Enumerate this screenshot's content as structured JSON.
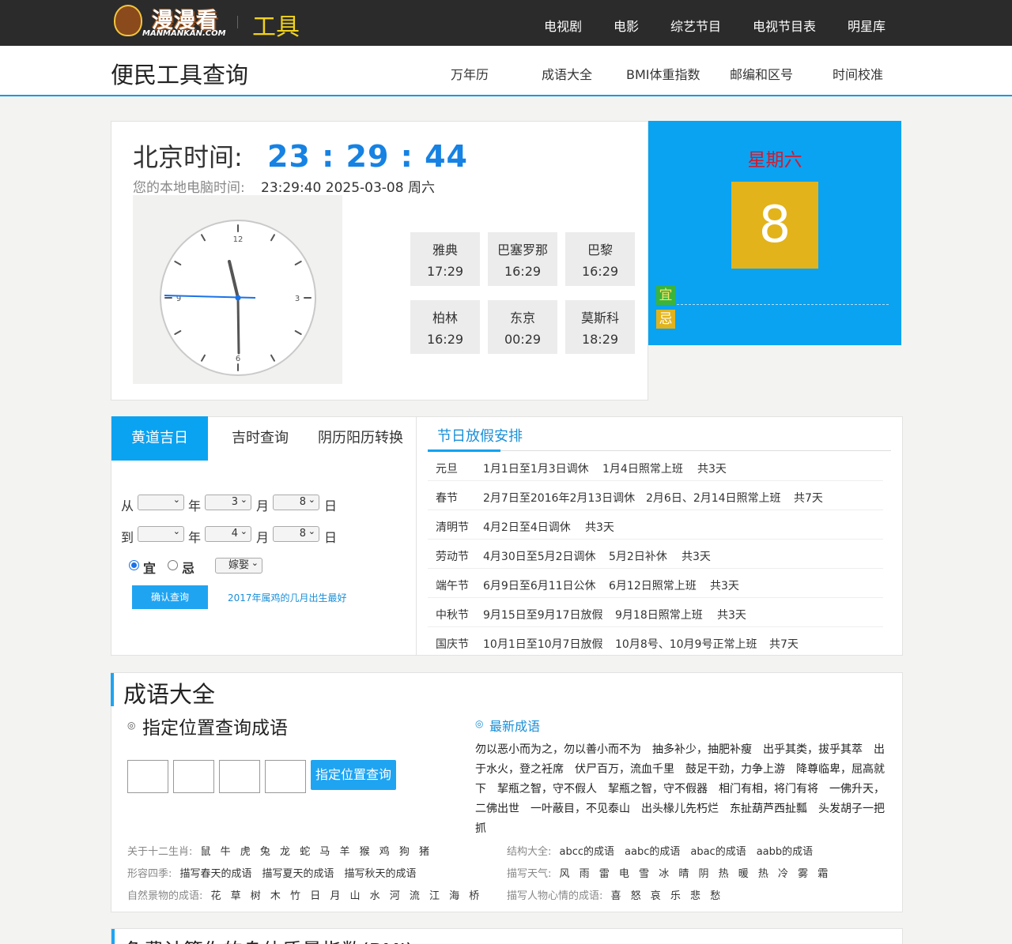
{
  "header": {
    "logo_text": "漫漫看",
    "logo_sub": "MANMANKAN.COM",
    "tool_title": "工具",
    "nav": [
      "电视剧",
      "电影",
      "综艺节目",
      "电视节目表",
      "明星库"
    ]
  },
  "subheader": {
    "title": "便民工具查询",
    "nav": [
      "万年历",
      "成语大全",
      "BMI体重指数",
      "邮编和区号",
      "时间校准"
    ]
  },
  "time_panel": {
    "beijing_label": "北京时间:",
    "beijing_time": "23 : 29 : 44",
    "local_label": "您的本地电脑时间:",
    "local_time": "23:29:40   2025-03-08 周六",
    "clock_numbers": [
      "12",
      "3",
      "6",
      "9"
    ],
    "cities": [
      {
        "name": "雅典",
        "time": "17:29"
      },
      {
        "name": "巴塞罗那",
        "time": "16:29"
      },
      {
        "name": "巴黎",
        "time": "16:29"
      },
      {
        "name": "柏林",
        "time": "16:29"
      },
      {
        "name": "东京",
        "time": "00:29"
      },
      {
        "name": "莫斯科",
        "time": "18:29"
      }
    ]
  },
  "calendar": {
    "weekday": "星期六",
    "day": "8",
    "yi": "宜",
    "ji": "忌"
  },
  "tabs": [
    "黄道吉日",
    "吉时查询",
    "阴历阳历转换"
  ],
  "date_form": {
    "from": "从",
    "to": "到",
    "year": "年",
    "month": "月",
    "day": "日",
    "from_month": "3",
    "from_day": "8",
    "to_month": "4",
    "to_day": "8",
    "radio_yi": "宜",
    "radio_ji": "忌",
    "event": "嫁娶",
    "submit": "确认查询",
    "link": "2017年属鸡的几月出生最好"
  },
  "holidays": {
    "title": "节日放假安排",
    "rows": [
      {
        "name": "元旦",
        "range": "1月1日至1月3日调休",
        "work": "1月4日照常上班",
        "total": "共3天"
      },
      {
        "name": "春节",
        "range": "2月7日至2016年2月13日调休",
        "work": "2月6日、2月14日照常上班",
        "total": "共7天"
      },
      {
        "name": "清明节",
        "range": "4月2日至4日调休",
        "work": "共3天",
        "total": ""
      },
      {
        "name": "劳动节",
        "range": "4月30日至5月2日调休",
        "work": "5月2日补休",
        "total": "共3天"
      },
      {
        "name": "端午节",
        "range": "6月9日至6月11日公休",
        "work": "6月12日照常上班",
        "total": "共3天"
      },
      {
        "name": "中秋节",
        "range": "9月15日至9月17日放假",
        "work": "9月18日照常上班",
        "total": "共3天"
      },
      {
        "name": "国庆节",
        "range": "10月1日至10月7日放假",
        "work": "10月8号、10月9号正常上班",
        "total": "共7天"
      }
    ]
  },
  "idioms": {
    "title": "成语大全",
    "bullet": "◎",
    "position_title": "指定位置查询成语",
    "position_button": "指定位置查询",
    "latest_title": "最新成语",
    "latest_text": "勿以恶小而为之，勿以善小而不为　抽多补少，抽肥补瘦　出乎其类，拔乎其萃　出于水火，登之衽席　伏尸百万，流血千里　鼓足干劲，力争上游　降尊临卑，屈高就下　挈瓶之智，守不假人　挈瓶之智，守不假器　相门有相，将门有将　一佛升天，二佛出世　一叶蔽目，不见泰山　出头椽儿先朽烂　东扯葫芦西扯瓢　头发胡子一把抓",
    "zodiac_label": "关于十二生肖:",
    "zodiac": "鼠 牛 虎 兔 龙 蛇 马 羊 猴 鸡 狗 猪",
    "seasons_label": "形容四季:",
    "seasons": "描写春天的成语　描写夏天的成语　描写秋天的成语",
    "nature_label": "自然景物的成语:",
    "nature": "花 草 树 木 竹 日 月 山 水 河 流 江 海 桥",
    "structure_label": "结构大全:",
    "structure": "abcc的成语　aabc的成语　abac的成语　aabb的成语",
    "weather_label": "描写天气:",
    "weather": "风 雨 雷 电 雪 冰 晴 阴 热 暖 热 冷 雾 霜",
    "mood_label": "描写人物心情的成语:",
    "mood": "喜 怒 哀 乐 悲 愁"
  },
  "bmi": {
    "title": "免费计算你的身体质量指数(BMI)"
  }
}
